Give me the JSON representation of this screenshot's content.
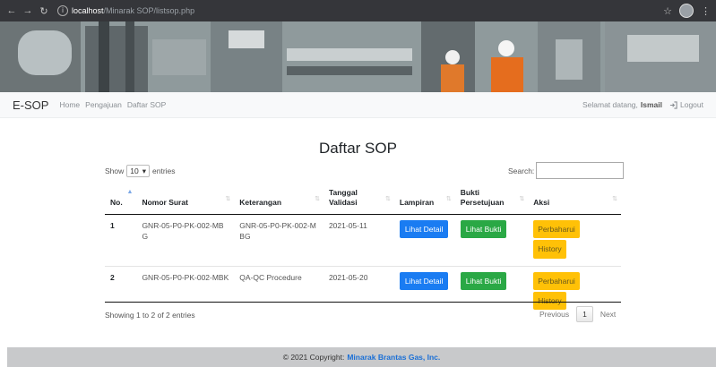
{
  "browser": {
    "url_host": "localhost",
    "url_path": "/Minarak SOP/listsop.php"
  },
  "navbar": {
    "brand": "E-SOP",
    "links": [
      "Home",
      "Pengajuan",
      "Daftar SOP"
    ],
    "greeting": "Selamat datang,",
    "username": "Ismail",
    "logout": "Logout"
  },
  "main": {
    "title": "Daftar SOP",
    "length": {
      "show": "Show",
      "value": "10",
      "entries": "entries"
    },
    "search_label": "Search:",
    "search_value": "",
    "columns": [
      "No.",
      "Nomor Surat",
      "Keterangan",
      "Tanggal Validasi",
      "Lampiran",
      "Bukti Persetujuan",
      "Aksi"
    ],
    "rows": [
      {
        "no": "1",
        "nomor_surat": "GNR-05-P0-PK-002-MBG",
        "keterangan": "GNR-05-P0-PK-002-MBG",
        "tanggal": "2021-05-11",
        "lampiran": "Lihat Detail",
        "bukti": "Lihat Bukti",
        "aksi_update": "Perbaharui",
        "aksi_history": "History"
      },
      {
        "no": "2",
        "nomor_surat": "GNR-05-P0-PK-002-MBK",
        "keterangan": "QA-QC Procedure",
        "tanggal": "2021-05-20",
        "lampiran": "Lihat Detail",
        "bukti": "Lihat Bukti",
        "aksi_update": "Perbaharui",
        "aksi_history": "History"
      }
    ],
    "info": "Showing 1 to 2 of 2 entries",
    "pager": {
      "previous": "Previous",
      "current": "1",
      "next": "Next"
    }
  },
  "footer": {
    "copyright": "© 2021 Copyright:",
    "company": "Minarak Brantas Gas, Inc."
  },
  "colors": {
    "primary": "#1a7cf2",
    "success": "#2aa845",
    "warning": "#ffc107",
    "footer_bg": "#c8c9cb"
  }
}
